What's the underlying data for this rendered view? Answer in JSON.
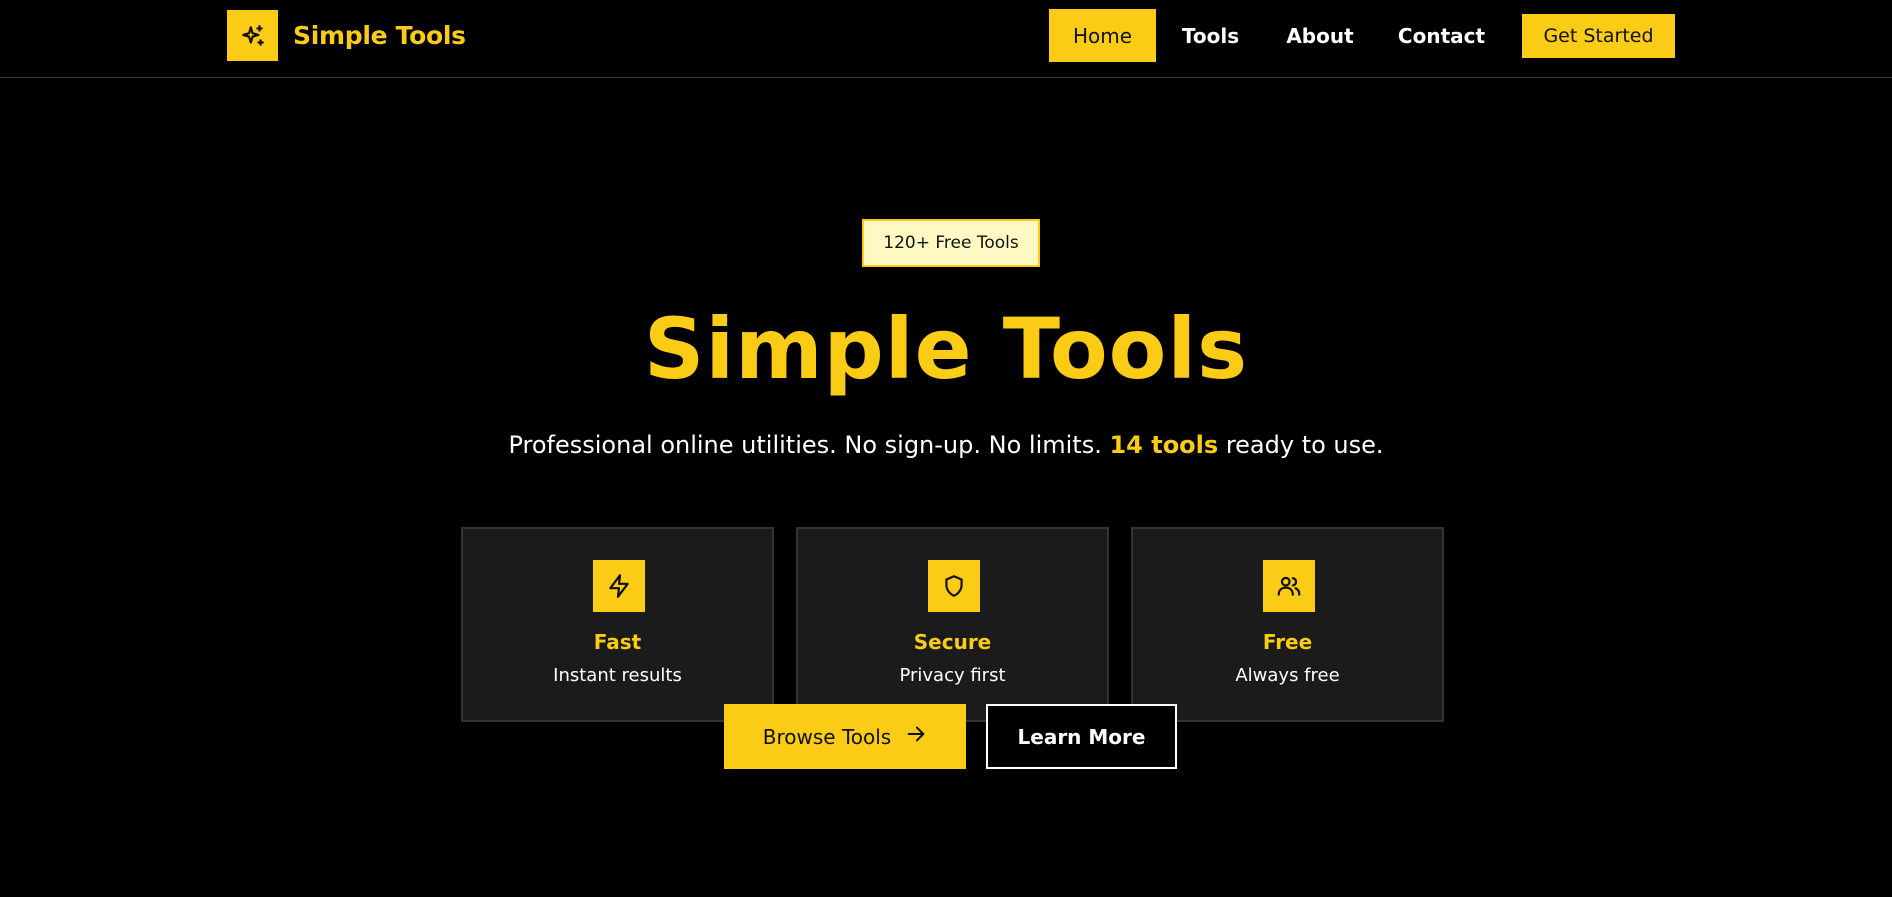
{
  "colors": {
    "accent": "#facc15",
    "background": "#000000",
    "card": "#1b1b1b",
    "badge_bg": "#fef9c3"
  },
  "brand": {
    "name": "Simple Tools",
    "icon": "sparkles-icon"
  },
  "nav": {
    "items": [
      {
        "label": "Home",
        "active": true
      },
      {
        "label": "Tools",
        "active": false
      },
      {
        "label": "About",
        "active": false
      },
      {
        "label": "Contact",
        "active": false
      }
    ],
    "cta_label": "Get Started"
  },
  "hero": {
    "badge": "120+ Free Tools",
    "title": "Simple Tools",
    "subtitle_before": "Professional online utilities. No sign-up. No limits.",
    "subtitle_highlight": "14 tools",
    "subtitle_after": "ready to use."
  },
  "features": [
    {
      "icon": "lightning-icon",
      "title": "Fast",
      "desc": "Instant results"
    },
    {
      "icon": "shield-icon",
      "title": "Secure",
      "desc": "Privacy first"
    },
    {
      "icon": "users-icon",
      "title": "Free",
      "desc": "Always free"
    }
  ],
  "actions": {
    "browse_label": "Browse Tools",
    "browse_icon": "arrow-right-icon",
    "learn_label": "Learn More"
  }
}
